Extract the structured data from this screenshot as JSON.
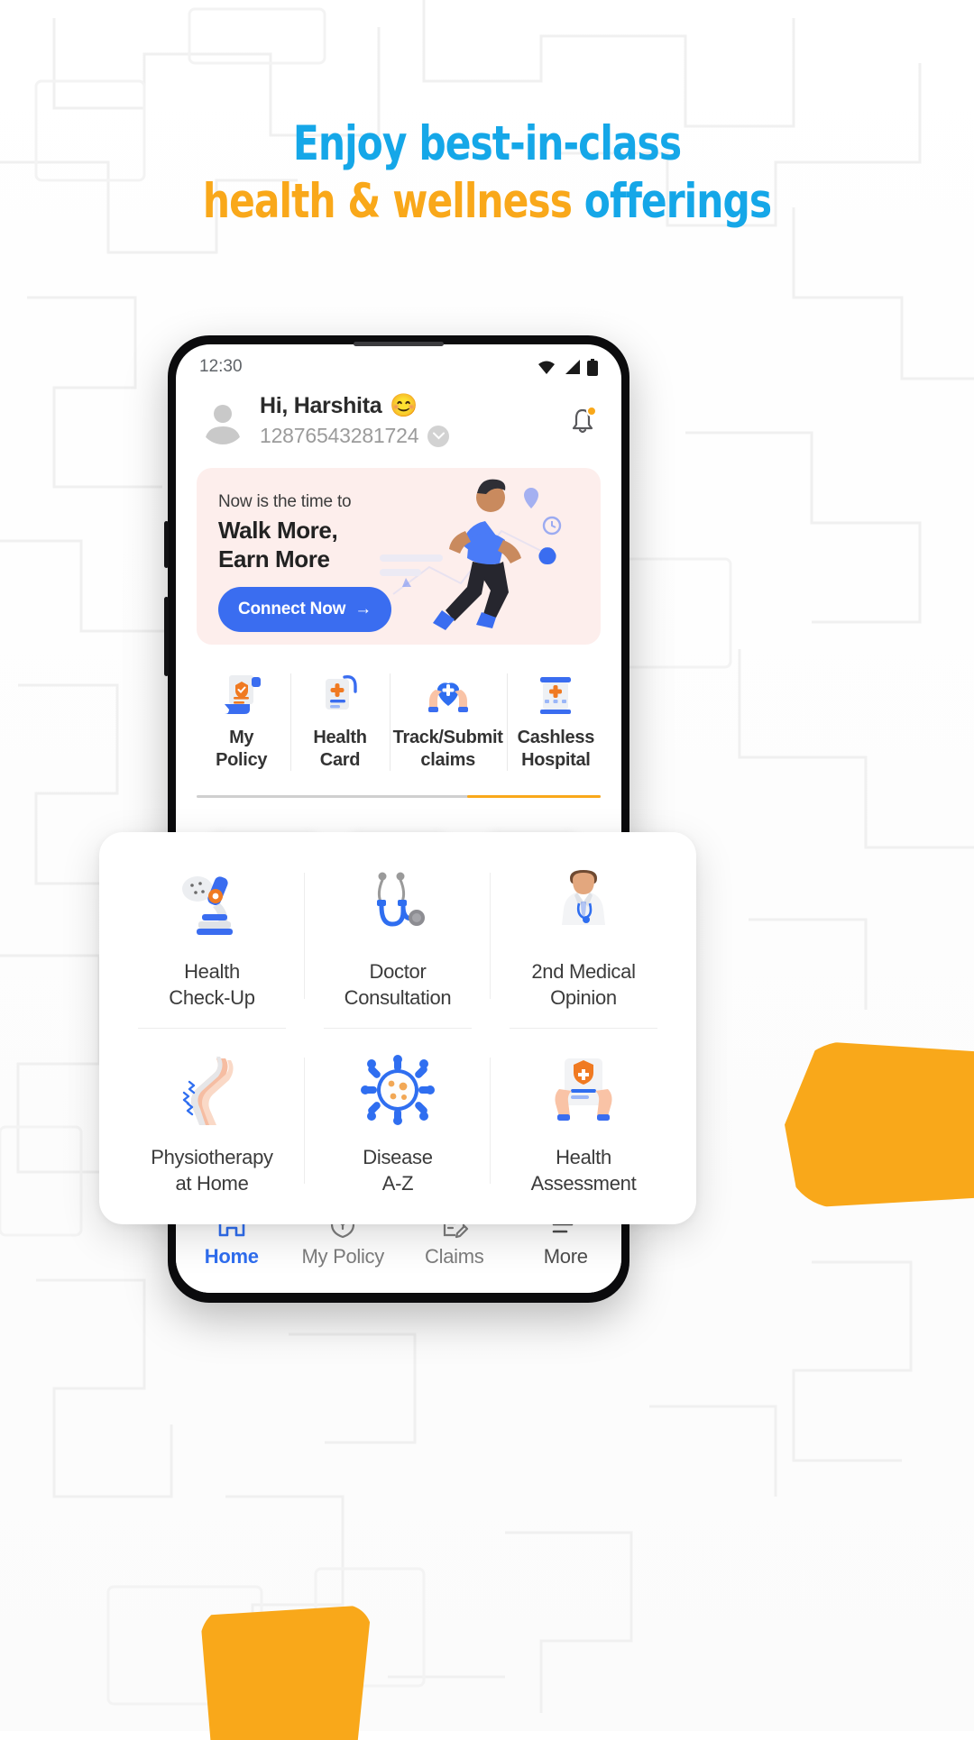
{
  "headline": {
    "line1": "Enjoy best-in-class",
    "line2_orange": "health & wellness ",
    "line2_blue": "offerings",
    "color_blue": "#15a7e8",
    "color_orange": "#f9a81a"
  },
  "phone": {
    "status": {
      "time": "12:30",
      "icons": [
        "wifi-icon",
        "signal-icon",
        "battery-icon"
      ]
    },
    "header": {
      "greeting": "Hi, Harshita",
      "emoji": "😊",
      "policy_number": "12876543281724",
      "chevron_icon": "chevron-down-icon",
      "notification_icon": "bell-icon"
    },
    "promo": {
      "kicker": "Now is the time to",
      "title_line1": "Walk More,",
      "title_line2": "Earn More",
      "button_label": "Connect Now",
      "button_arrow": "→",
      "button_color": "#3a6df0",
      "background_color": "#fdeeec",
      "illustration": "running-person-illustration"
    },
    "quick_actions": [
      {
        "label_line1": "My",
        "label_line2": "Policy",
        "icon": "policy-document-icon"
      },
      {
        "label_line1": "Health",
        "label_line2": "Card",
        "icon": "health-card-icon"
      },
      {
        "label_line1": "Track/Submit",
        "label_line2": "claims",
        "icon": "heart-in-hands-icon"
      },
      {
        "label_line1": "Cashless",
        "label_line2": "Hospital",
        "icon": "hospital-icon"
      }
    ],
    "bottom_nav": [
      {
        "label": "Home",
        "icon": "home-icon",
        "active": true
      },
      {
        "label": "My Policy",
        "icon": "shield-icon",
        "active": false
      },
      {
        "label": "Claims",
        "icon": "claims-icon",
        "active": false
      },
      {
        "label": "More",
        "icon": "hamburger-icon",
        "active": false
      }
    ]
  },
  "services_card": {
    "items": [
      {
        "label_line1": "Health",
        "label_line2": "Check-Up",
        "icon": "microscope-icon"
      },
      {
        "label_line1": "Doctor",
        "label_line2": "Consultation",
        "icon": "stethoscope-icon"
      },
      {
        "label_line1": "2nd Medical",
        "label_line2": "Opinion",
        "icon": "doctor-avatar-icon"
      },
      {
        "label_line1": "Physiotherapy",
        "label_line2": "at Home",
        "icon": "knee-joint-icon"
      },
      {
        "label_line1": "Disease",
        "label_line2": "A-Z",
        "icon": "virus-icon"
      },
      {
        "label_line1": "Health",
        "label_line2": "Assessment",
        "icon": "health-report-icon"
      }
    ]
  },
  "decor": {
    "ribbon_color": "#f9a81a",
    "background": "maze-pattern"
  }
}
